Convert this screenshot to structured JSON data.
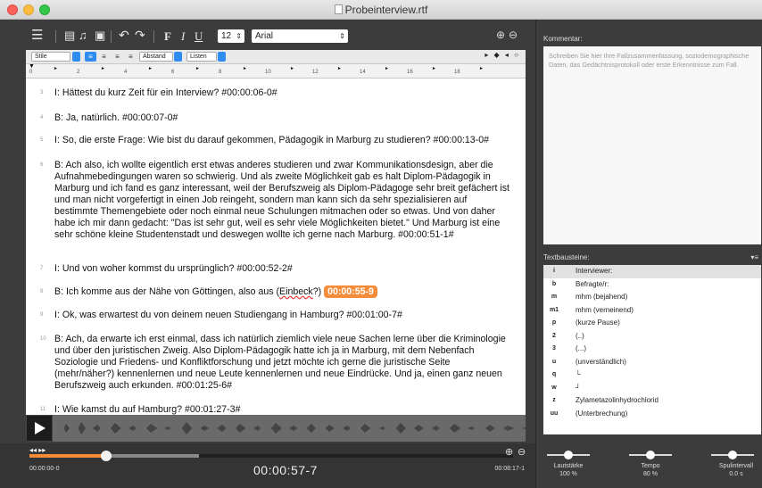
{
  "window": {
    "title": "Probeinterview.rtf"
  },
  "toolbar": {
    "font_size": "12",
    "font_name": "Arial",
    "format_bold": "F",
    "format_italic": "I",
    "format_underline": "U",
    "style_select": "Stile",
    "spacing_select": "Abstand",
    "lists_select": "Listen",
    "nav_arrows": "▸ ◆ ◂ ○"
  },
  "ruler": {
    "numbers": [
      "0",
      "2",
      "4",
      "6",
      "8",
      "10",
      "12",
      "14",
      "16",
      "18"
    ]
  },
  "document": {
    "paragraphs": [
      {
        "num": "3",
        "text": "I: Hättest du kurz Zeit für ein Interview? #00:00:06-0#"
      },
      {
        "num": "4",
        "text": "B: Ja, natürlich. #00:00:07-0#"
      },
      {
        "num": "5",
        "text": "I: So, die erste Frage: Wie bist du darauf gekommen, Pädagogik in Marburg zu studieren? #00:00:13-0#"
      },
      {
        "num": "6",
        "text": "B: Ach also, ich wollte eigentlich erst etwas anderes studieren und zwar Kommunikationsdesign, aber die Aufnahmebedingungen waren so schwierig. Und als zweite Möglichkeit gab es halt Diplom-Pädagogik in Marburg und ich fand es ganz interessant, weil der Berufszweig als Diplom-Pädagoge sehr breit gefächert ist und man nicht vorgefertigt in einen Job reingeht, sondern man kann sich da sehr spezialisieren auf bestimmte Themengebiete oder noch einmal neue Schulungen mitmachen oder so etwas. Und von daher habe ich mir dann gedacht: \"Das ist sehr gut, weil es sehr viele Möglichkeiten bietet.\" Und Marburg ist eine sehr schöne kleine Studentenstadt und deswegen wollte ich gerne nach Marburg. #00:00:51-1#"
      },
      {
        "num": "7",
        "text": "I: Und von woher kommst du ursprünglich? #00:00:52-2#"
      },
      {
        "num": "8",
        "text_before": "B: Ich komme aus der Nähe von Göttingen, also aus (",
        "text_misspelled": "Einbeck",
        "text_after": "?) ",
        "timestamp_badge": "00:00:55-9"
      },
      {
        "num": "9",
        "text": "I: Ok, was erwartest du von deinem neuen Studiengang in Hamburg? #00:01:00-7#"
      },
      {
        "num": "10",
        "text": "B: Ach, da erwarte ich erst einmal, dass ich natürlich ziemlich viele neue Sachen lerne über die Kriminologie und über den juristischen Zweig. Also Diplom-Pädagogik hatte ich ja in Marburg, mit dem Nebenfach Soziologie und Friedens- und Konfliktforschung und jetzt möchte ich gerne die juristische Seite (mehr/näher?) kennenlernen und neue Leute kennenlernen und neue Eindrücke. Und ja, einen ganz neuen Berufszweig auch erkunden. #00:01:25-6#"
      },
      {
        "num": "11",
        "text": "I: Wie kamst du auf Hamburg? #00:01:27-3#"
      }
    ]
  },
  "player": {
    "time_start": "00:00:00-0",
    "time_current": "00:00:57-7",
    "time_end": "00:08:17-1",
    "progress": 0.158,
    "buffered": 0.35,
    "ff_icons": "◂◂ ▸▸"
  },
  "comment": {
    "label": "Kommentar:",
    "placeholder": "Schreiben Sie hier Ihre Fallzusammenfassung, soziodemographische Daten, das Gedächtnisprotokoll oder erste Erkenntnisse zum Fall."
  },
  "textbausteine": {
    "label": "Textbausteine:",
    "items": [
      {
        "key": "i",
        "value": "Interviewer:"
      },
      {
        "key": "b",
        "value": "Befragte/r:"
      },
      {
        "key": "m",
        "value": "mhm (bejahend)"
      },
      {
        "key": "m1",
        "value": "mhm (verneinend)"
      },
      {
        "key": "p",
        "value": "(kurze Pause)"
      },
      {
        "key": "2",
        "value": "(..)"
      },
      {
        "key": "3",
        "value": "(...)"
      },
      {
        "key": "u",
        "value": "(unverständlich)"
      },
      {
        "key": "q",
        "value": "└"
      },
      {
        "key": "w",
        "value": "┘"
      },
      {
        "key": "z",
        "value": "Zylametazolinhydrochlorid"
      },
      {
        "key": "uu",
        "value": "(Unterbrechung)"
      }
    ]
  },
  "sliders": {
    "volume": {
      "label": "Lautstärke",
      "value_text": "100 %",
      "level": 0.5
    },
    "tempo": {
      "label": "Tempo",
      "value_text": "80 %",
      "level": 0.5
    },
    "rewind": {
      "label": "Spulintervall",
      "value_text": "0.0 s",
      "level": 0.5
    }
  },
  "colors": {
    "accent": "#f48c3a",
    "selection_blue": "#2f8cf2"
  }
}
